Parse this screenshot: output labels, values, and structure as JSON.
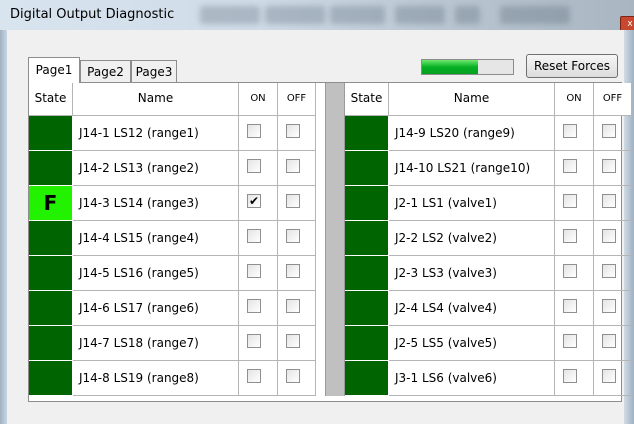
{
  "window": {
    "title": "Digital Output Diagnostic",
    "close_label": "x"
  },
  "tabs": [
    {
      "label": "Page1"
    },
    {
      "label": "Page2"
    },
    {
      "label": "Page3"
    }
  ],
  "progress": {
    "fraction": 0.62,
    "color": "#06b025"
  },
  "reset_button": "Reset Forces",
  "columns": {
    "state": "State",
    "name": "Name",
    "on": "ON",
    "off": "OFF"
  },
  "left_rows": [
    {
      "name": "J14-1 LS12 (range1)",
      "state_text": "",
      "forced": false,
      "on_checked": false,
      "off_checked": false
    },
    {
      "name": "J14-2 LS13 (range2)",
      "state_text": "",
      "forced": false,
      "on_checked": false,
      "off_checked": false
    },
    {
      "name": "J14-3 LS14 (range3)",
      "state_text": "F",
      "forced": true,
      "on_checked": true,
      "off_checked": false
    },
    {
      "name": "J14-4 LS15 (range4)",
      "state_text": "",
      "forced": false,
      "on_checked": false,
      "off_checked": false
    },
    {
      "name": "J14-5 LS16 (range5)",
      "state_text": "",
      "forced": false,
      "on_checked": false,
      "off_checked": false
    },
    {
      "name": "J14-6 LS17 (range6)",
      "state_text": "",
      "forced": false,
      "on_checked": false,
      "off_checked": false
    },
    {
      "name": "J14-7 LS18 (range7)",
      "state_text": "",
      "forced": false,
      "on_checked": false,
      "off_checked": false
    },
    {
      "name": "J14-8 LS19 (range8)",
      "state_text": "",
      "forced": false,
      "on_checked": false,
      "off_checked": false
    }
  ],
  "right_rows": [
    {
      "name": "J14-9 LS20 (range9)",
      "state_text": "",
      "forced": false,
      "on_checked": false,
      "off_checked": false
    },
    {
      "name": "J14-10 LS21 (range10)",
      "state_text": "",
      "forced": false,
      "on_checked": false,
      "off_checked": false
    },
    {
      "name": "J2-1 LS1 (valve1)",
      "state_text": "",
      "forced": false,
      "on_checked": false,
      "off_checked": false
    },
    {
      "name": "J2-2 LS2 (valve2)",
      "state_text": "",
      "forced": false,
      "on_checked": false,
      "off_checked": false
    },
    {
      "name": "J2-3 LS3 (valve3)",
      "state_text": "",
      "forced": false,
      "on_checked": false,
      "off_checked": false
    },
    {
      "name": "J2-4 LS4 (valve4)",
      "state_text": "",
      "forced": false,
      "on_checked": false,
      "off_checked": false
    },
    {
      "name": "J2-5 LS5 (valve5)",
      "state_text": "",
      "forced": false,
      "on_checked": false,
      "off_checked": false
    },
    {
      "name": "J3-1 LS6 (valve6)",
      "state_text": "",
      "forced": false,
      "on_checked": false,
      "off_checked": false
    }
  ],
  "colors": {
    "state_off": "#006400",
    "state_forced": "#22f200"
  },
  "check_glyph": "✔"
}
